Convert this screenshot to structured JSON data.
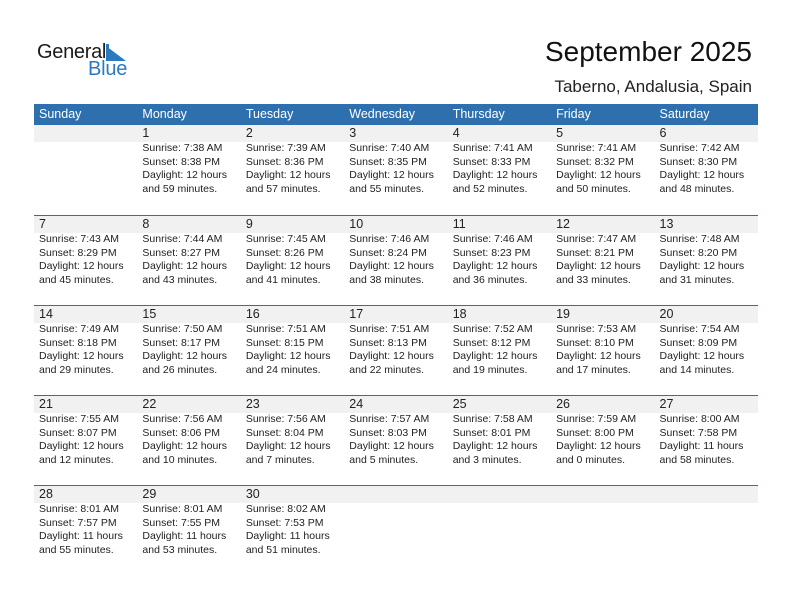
{
  "logo": {
    "general": "General",
    "blue": "Blue"
  },
  "header": {
    "title": "September 2025",
    "location": "Taberno, Andalusia, Spain"
  },
  "colors": {
    "accent": "#2e6fad",
    "strip": "#f1f1f1",
    "logo_blue": "#2a7abf"
  },
  "weekdays": [
    "Sunday",
    "Monday",
    "Tuesday",
    "Wednesday",
    "Thursday",
    "Friday",
    "Saturday"
  ],
  "weeks": [
    [
      null,
      {
        "day": "1",
        "sunrise": "Sunrise: 7:38 AM",
        "sunset": "Sunset: 8:38 PM",
        "daylight1": "Daylight: 12 hours",
        "daylight2": "and 59 minutes."
      },
      {
        "day": "2",
        "sunrise": "Sunrise: 7:39 AM",
        "sunset": "Sunset: 8:36 PM",
        "daylight1": "Daylight: 12 hours",
        "daylight2": "and 57 minutes."
      },
      {
        "day": "3",
        "sunrise": "Sunrise: 7:40 AM",
        "sunset": "Sunset: 8:35 PM",
        "daylight1": "Daylight: 12 hours",
        "daylight2": "and 55 minutes."
      },
      {
        "day": "4",
        "sunrise": "Sunrise: 7:41 AM",
        "sunset": "Sunset: 8:33 PM",
        "daylight1": "Daylight: 12 hours",
        "daylight2": "and 52 minutes."
      },
      {
        "day": "5",
        "sunrise": "Sunrise: 7:41 AM",
        "sunset": "Sunset: 8:32 PM",
        "daylight1": "Daylight: 12 hours",
        "daylight2": "and 50 minutes."
      },
      {
        "day": "6",
        "sunrise": "Sunrise: 7:42 AM",
        "sunset": "Sunset: 8:30 PM",
        "daylight1": "Daylight: 12 hours",
        "daylight2": "and 48 minutes."
      }
    ],
    [
      {
        "day": "7",
        "sunrise": "Sunrise: 7:43 AM",
        "sunset": "Sunset: 8:29 PM",
        "daylight1": "Daylight: 12 hours",
        "daylight2": "and 45 minutes."
      },
      {
        "day": "8",
        "sunrise": "Sunrise: 7:44 AM",
        "sunset": "Sunset: 8:27 PM",
        "daylight1": "Daylight: 12 hours",
        "daylight2": "and 43 minutes."
      },
      {
        "day": "9",
        "sunrise": "Sunrise: 7:45 AM",
        "sunset": "Sunset: 8:26 PM",
        "daylight1": "Daylight: 12 hours",
        "daylight2": "and 41 minutes."
      },
      {
        "day": "10",
        "sunrise": "Sunrise: 7:46 AM",
        "sunset": "Sunset: 8:24 PM",
        "daylight1": "Daylight: 12 hours",
        "daylight2": "and 38 minutes."
      },
      {
        "day": "11",
        "sunrise": "Sunrise: 7:46 AM",
        "sunset": "Sunset: 8:23 PM",
        "daylight1": "Daylight: 12 hours",
        "daylight2": "and 36 minutes."
      },
      {
        "day": "12",
        "sunrise": "Sunrise: 7:47 AM",
        "sunset": "Sunset: 8:21 PM",
        "daylight1": "Daylight: 12 hours",
        "daylight2": "and 33 minutes."
      },
      {
        "day": "13",
        "sunrise": "Sunrise: 7:48 AM",
        "sunset": "Sunset: 8:20 PM",
        "daylight1": "Daylight: 12 hours",
        "daylight2": "and 31 minutes."
      }
    ],
    [
      {
        "day": "14",
        "sunrise": "Sunrise: 7:49 AM",
        "sunset": "Sunset: 8:18 PM",
        "daylight1": "Daylight: 12 hours",
        "daylight2": "and 29 minutes."
      },
      {
        "day": "15",
        "sunrise": "Sunrise: 7:50 AM",
        "sunset": "Sunset: 8:17 PM",
        "daylight1": "Daylight: 12 hours",
        "daylight2": "and 26 minutes."
      },
      {
        "day": "16",
        "sunrise": "Sunrise: 7:51 AM",
        "sunset": "Sunset: 8:15 PM",
        "daylight1": "Daylight: 12 hours",
        "daylight2": "and 24 minutes."
      },
      {
        "day": "17",
        "sunrise": "Sunrise: 7:51 AM",
        "sunset": "Sunset: 8:13 PM",
        "daylight1": "Daylight: 12 hours",
        "daylight2": "and 22 minutes."
      },
      {
        "day": "18",
        "sunrise": "Sunrise: 7:52 AM",
        "sunset": "Sunset: 8:12 PM",
        "daylight1": "Daylight: 12 hours",
        "daylight2": "and 19 minutes."
      },
      {
        "day": "19",
        "sunrise": "Sunrise: 7:53 AM",
        "sunset": "Sunset: 8:10 PM",
        "daylight1": "Daylight: 12 hours",
        "daylight2": "and 17 minutes."
      },
      {
        "day": "20",
        "sunrise": "Sunrise: 7:54 AM",
        "sunset": "Sunset: 8:09 PM",
        "daylight1": "Daylight: 12 hours",
        "daylight2": "and 14 minutes."
      }
    ],
    [
      {
        "day": "21",
        "sunrise": "Sunrise: 7:55 AM",
        "sunset": "Sunset: 8:07 PM",
        "daylight1": "Daylight: 12 hours",
        "daylight2": "and 12 minutes."
      },
      {
        "day": "22",
        "sunrise": "Sunrise: 7:56 AM",
        "sunset": "Sunset: 8:06 PM",
        "daylight1": "Daylight: 12 hours",
        "daylight2": "and 10 minutes."
      },
      {
        "day": "23",
        "sunrise": "Sunrise: 7:56 AM",
        "sunset": "Sunset: 8:04 PM",
        "daylight1": "Daylight: 12 hours",
        "daylight2": "and 7 minutes."
      },
      {
        "day": "24",
        "sunrise": "Sunrise: 7:57 AM",
        "sunset": "Sunset: 8:03 PM",
        "daylight1": "Daylight: 12 hours",
        "daylight2": "and 5 minutes."
      },
      {
        "day": "25",
        "sunrise": "Sunrise: 7:58 AM",
        "sunset": "Sunset: 8:01 PM",
        "daylight1": "Daylight: 12 hours",
        "daylight2": "and 3 minutes."
      },
      {
        "day": "26",
        "sunrise": "Sunrise: 7:59 AM",
        "sunset": "Sunset: 8:00 PM",
        "daylight1": "Daylight: 12 hours",
        "daylight2": "and 0 minutes."
      },
      {
        "day": "27",
        "sunrise": "Sunrise: 8:00 AM",
        "sunset": "Sunset: 7:58 PM",
        "daylight1": "Daylight: 11 hours",
        "daylight2": "and 58 minutes."
      }
    ],
    [
      {
        "day": "28",
        "sunrise": "Sunrise: 8:01 AM",
        "sunset": "Sunset: 7:57 PM",
        "daylight1": "Daylight: 11 hours",
        "daylight2": "and 55 minutes."
      },
      {
        "day": "29",
        "sunrise": "Sunrise: 8:01 AM",
        "sunset": "Sunset: 7:55 PM",
        "daylight1": "Daylight: 11 hours",
        "daylight2": "and 53 minutes."
      },
      {
        "day": "30",
        "sunrise": "Sunrise: 8:02 AM",
        "sunset": "Sunset: 7:53 PM",
        "daylight1": "Daylight: 11 hours",
        "daylight2": "and 51 minutes."
      },
      null,
      null,
      null,
      null
    ]
  ]
}
